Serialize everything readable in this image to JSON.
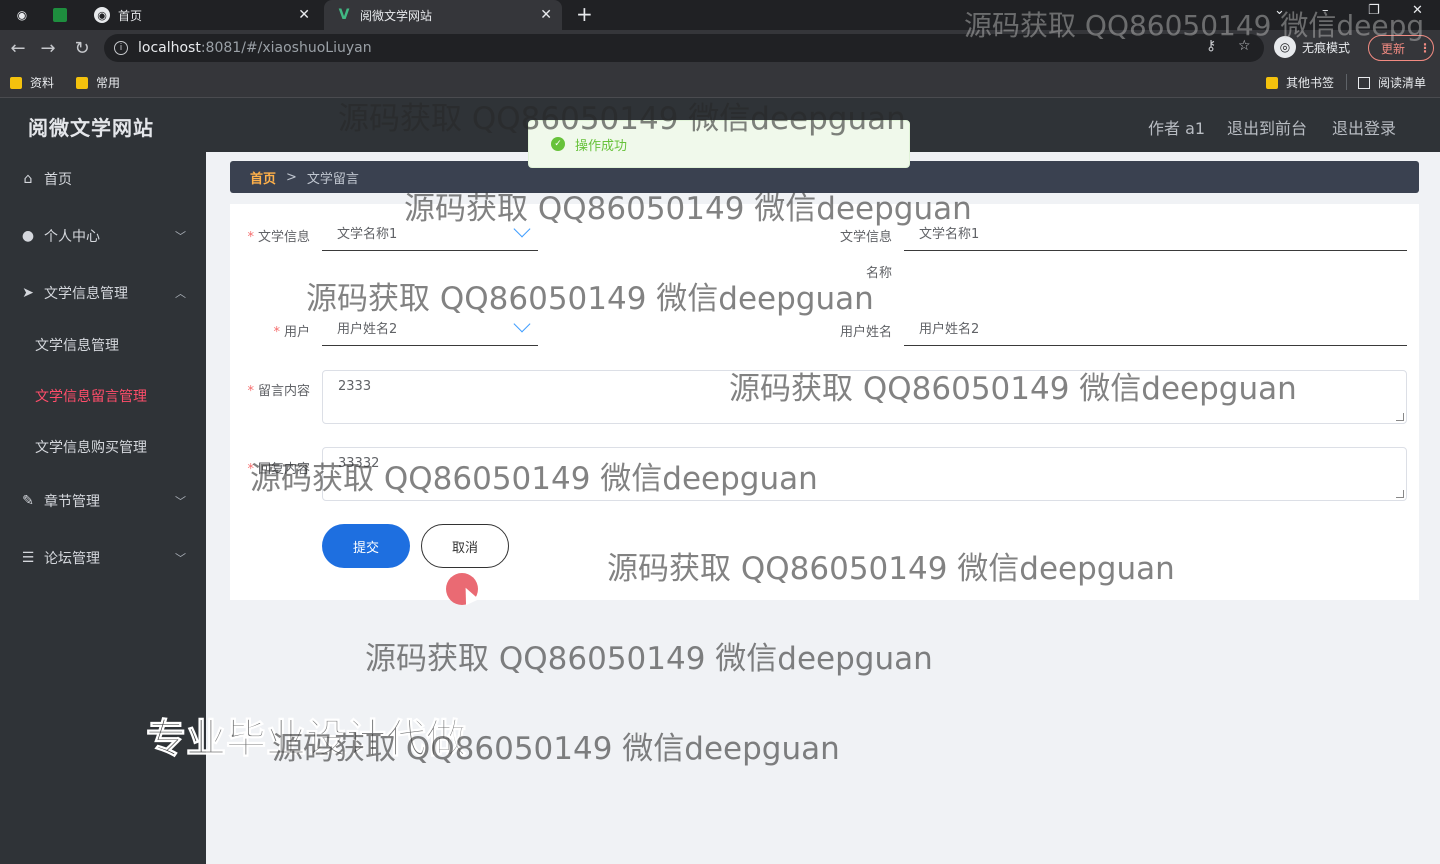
{
  "browser": {
    "tabs": [
      {
        "title": "首页"
      },
      {
        "title": "阅微文学网站"
      }
    ],
    "url_host": "localhost",
    "url_path": ":8081/#/xiaoshuoLiuyan",
    "incognito_label": "无痕模式",
    "update_label": "更新",
    "bookmarks": [
      "资料",
      "常用"
    ],
    "other_bookmarks": "其他书签",
    "reading_list": "阅读清单"
  },
  "app": {
    "title": "阅微文学网站",
    "header_links": [
      "作者 a1",
      "退出到前台",
      "退出登录"
    ]
  },
  "sidebar": {
    "items": [
      {
        "label": "首页",
        "icon": "home-icon"
      },
      {
        "label": "个人中心",
        "icon": "user-icon"
      },
      {
        "label": "文学信息管理",
        "icon": "send-icon"
      },
      {
        "label": "章节管理",
        "icon": "edit-icon"
      },
      {
        "label": "论坛管理",
        "icon": "list-icon"
      }
    ],
    "subitems": [
      "文学信息管理",
      "文学信息留言管理",
      "文学信息购买管理"
    ]
  },
  "breadcrumb": {
    "home": "首页",
    "separator": ">",
    "current": "文学留言"
  },
  "form": {
    "wenxue_label": "文学信息",
    "wenxue_value": "文学名称1",
    "wenxue_name_label_1": "文学信息",
    "wenxue_name_label_2": "名称",
    "wenxue_name_value": "文学名称1",
    "user_label": "用户",
    "user_value": "用户姓名2",
    "user_name_label": "用户姓名",
    "user_name_value": "用户姓名2",
    "content_label": "留言内容",
    "content_value": "2333",
    "reply_label": "回复内容",
    "reply_value": "33332",
    "submit": "提交",
    "cancel": "取消"
  },
  "toast": {
    "message": "操作成功"
  },
  "watermark": {
    "text": "源码获取 QQ86050149 微信deepguan",
    "top_text": "源码获取 QQ86050149 微信deepg",
    "promo": "专业毕业设计代做"
  }
}
